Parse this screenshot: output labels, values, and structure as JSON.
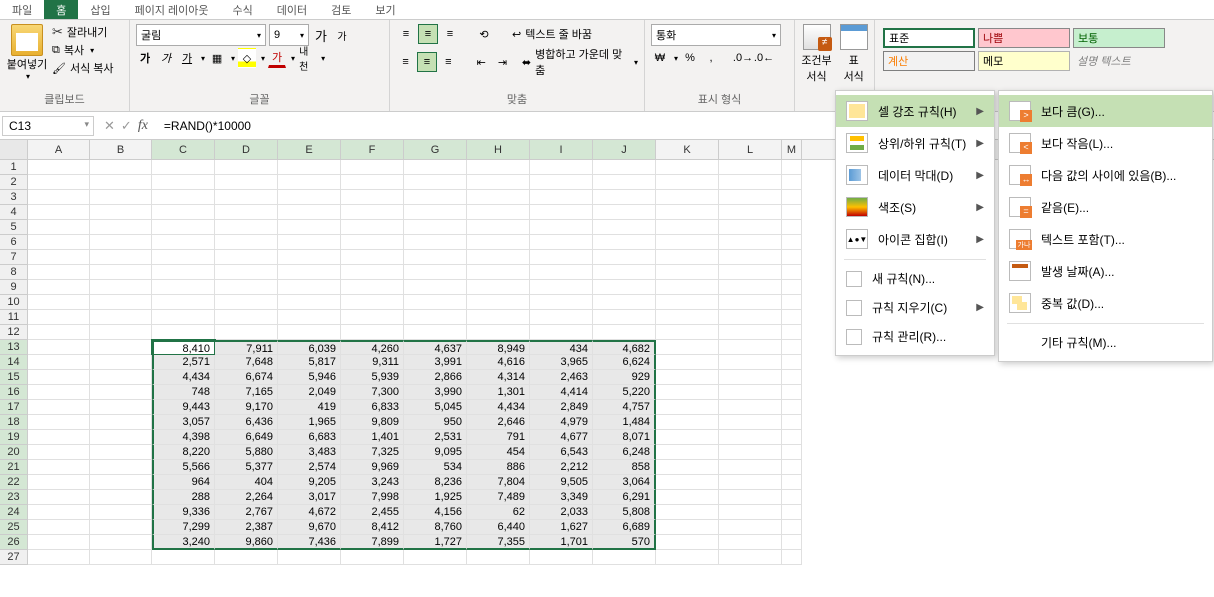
{
  "tabs": [
    "파일",
    "홈",
    "삽입",
    "페이지 레이아웃",
    "수식",
    "데이터",
    "검토",
    "보기"
  ],
  "active_tab": 1,
  "clipboard": {
    "paste": "붙여넣기",
    "cut": "잘라내기",
    "copy": "복사",
    "format_painter": "서식 복사",
    "group": "클립보드"
  },
  "font": {
    "name": "굴림",
    "size": "9",
    "increase": "가",
    "decrease": "가",
    "bold": "가",
    "italic": "가",
    "underline": "가",
    "hangul": "내천",
    "color": "가",
    "group": "글꼴"
  },
  "align": {
    "wrap": "텍스트 줄 바꿈",
    "merge": "병합하고 가운데 맞춤",
    "group": "맞춤"
  },
  "number": {
    "format": "통화",
    "group": "표시 형식"
  },
  "cond": {
    "cond_format": "조건부\n서식",
    "table_format": "표\n서식"
  },
  "styles": {
    "normal": "표준",
    "bad": "나쁨",
    "good": "보통",
    "calc": "계산",
    "memo": "메모",
    "explain": "설명 텍스트",
    "group": "스타일"
  },
  "formula_bar": {
    "name_box": "C13",
    "formula": "=RAND()*10000"
  },
  "columns": [
    "A",
    "B",
    "C",
    "D",
    "E",
    "F",
    "G",
    "H",
    "I",
    "J",
    "K",
    "L",
    "M"
  ],
  "sel_cols_start": 2,
  "sel_cols_end": 9,
  "row_start": 1,
  "row_end": 27,
  "sel_rows_start": 13,
  "sel_rows_end": 26,
  "active_cell": {
    "row": 13,
    "col": 2
  },
  "grid": {
    "13": [
      "8,410",
      "7,911",
      "6,039",
      "4,260",
      "4,637",
      "8,949",
      "434",
      "4,682"
    ],
    "14": [
      "2,571",
      "7,648",
      "5,817",
      "9,311",
      "3,991",
      "4,616",
      "3,965",
      "6,624"
    ],
    "15": [
      "4,434",
      "6,674",
      "5,946",
      "5,939",
      "2,866",
      "4,314",
      "2,463",
      "929"
    ],
    "16": [
      "748",
      "7,165",
      "2,049",
      "7,300",
      "3,990",
      "1,301",
      "4,414",
      "5,220"
    ],
    "17": [
      "9,443",
      "9,170",
      "419",
      "6,833",
      "5,045",
      "4,434",
      "2,849",
      "4,757"
    ],
    "18": [
      "3,057",
      "6,436",
      "1,965",
      "9,809",
      "950",
      "2,646",
      "4,979",
      "1,484"
    ],
    "19": [
      "4,398",
      "6,649",
      "6,683",
      "1,401",
      "2,531",
      "791",
      "4,677",
      "8,071"
    ],
    "20": [
      "8,220",
      "5,880",
      "3,483",
      "7,325",
      "9,095",
      "454",
      "6,543",
      "6,248"
    ],
    "21": [
      "5,566",
      "5,377",
      "2,574",
      "9,969",
      "534",
      "886",
      "2,212",
      "858"
    ],
    "22": [
      "964",
      "404",
      "9,205",
      "3,243",
      "8,236",
      "7,804",
      "9,505",
      "3,064"
    ],
    "23": [
      "288",
      "2,264",
      "3,017",
      "7,998",
      "1,925",
      "7,489",
      "3,349",
      "6,291"
    ],
    "24": [
      "9,336",
      "2,767",
      "4,672",
      "2,455",
      "4,156",
      "62",
      "2,033",
      "5,808"
    ],
    "25": [
      "7,299",
      "2,387",
      "9,670",
      "8,412",
      "8,760",
      "6,440",
      "1,627",
      "6,689"
    ],
    "26": [
      "3,240",
      "9,860",
      "7,436",
      "7,899",
      "1,727",
      "7,355",
      "1,701",
      "570"
    ]
  },
  "menu1": {
    "highlight": "셀 강조 규칙(H)",
    "topbot": "상위/하위 규칙(T)",
    "databar": "데이터 막대(D)",
    "colorscale": "색조(S)",
    "iconset": "아이콘 집합(I)",
    "new_rule": "새 규칙(N)...",
    "clear": "규칙 지우기(C)",
    "manage": "규칙 관리(R)..."
  },
  "menu2": {
    "gt": "보다 큼(G)...",
    "lt": "보다 작음(L)...",
    "between": "다음 값의 사이에 있음(B)...",
    "eq": "같음(E)...",
    "text": "텍스트 포함(T)...",
    "date": "발생 날짜(A)...",
    "dup": "중복 값(D)...",
    "more": "기타 규칙(M)..."
  }
}
